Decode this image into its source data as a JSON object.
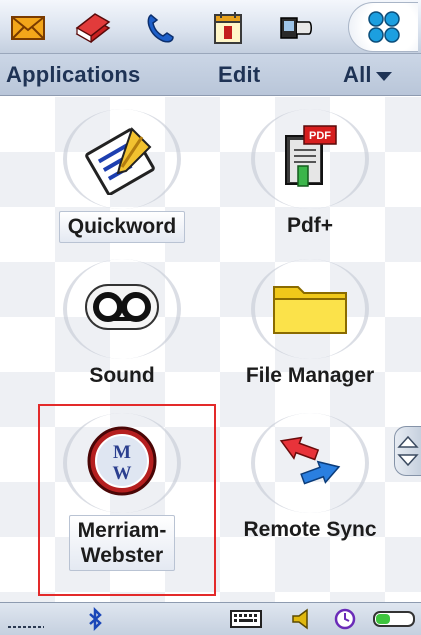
{
  "tabs": [
    {
      "icon": "mail-icon"
    },
    {
      "icon": "books-icon"
    },
    {
      "icon": "phone-icon"
    },
    {
      "icon": "calendar-icon"
    },
    {
      "icon": "connectivity-icon"
    },
    {
      "icon": "applications-grid-icon",
      "selected": true
    }
  ],
  "menu": {
    "applications": "Applications",
    "edit": "Edit",
    "filter": "All"
  },
  "apps": [
    {
      "label": "Quickword",
      "icon": "quickword-icon",
      "highlighted": true
    },
    {
      "label": "Pdf+",
      "icon": "pdf-icon"
    },
    {
      "label": "Sound",
      "icon": "sound-recorder-icon"
    },
    {
      "label": "File Manager",
      "icon": "folder-icon"
    },
    {
      "label": "Merriam-\nWebster",
      "icon": "merriam-webster-icon",
      "highlighted": true,
      "selected": true
    },
    {
      "label": "Remote Sync",
      "icon": "remote-sync-icon"
    }
  ],
  "status": {
    "icons": [
      "bluetooth-icon",
      "keyboard-icon",
      "volume-icon",
      "clock-icon",
      "battery-icon"
    ]
  },
  "colors": {
    "accent": "#1f3355",
    "selection": "#e32a2a"
  }
}
